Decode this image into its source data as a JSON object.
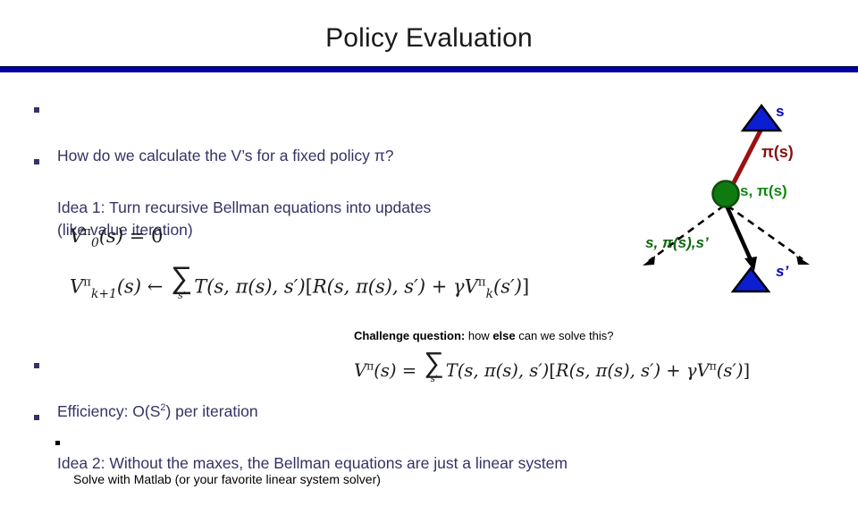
{
  "slide": {
    "title": "Policy Evaluation",
    "accent_bar_color": "#0000b4",
    "body_text_color": "#333366"
  },
  "bullets": [
    {
      "id": "how-do-we-calculate",
      "text": "How do we calculate the V’s for a fixed policy π?",
      "level": 1
    },
    {
      "id": "idea-1",
      "text": "Idea 1: Turn recursive Bellman equations into updates\n(like value iteration)",
      "level": 1
    },
    {
      "id": "efficiency",
      "text_before_sup": "Efficiency: O(S",
      "sup": "2",
      "text_after_sup": ") per iteration",
      "level": 1
    },
    {
      "id": "idea-2",
      "text": "Idea 2: Without the maxes, the Bellman equations are just a linear system",
      "level": 1
    },
    {
      "id": "solve-with-matlab",
      "text": "Solve with Matlab (or your favorite linear system solver)",
      "level": 2
    }
  ],
  "equations": {
    "eq_init": {
      "label": "V0^pi(s) = 0",
      "V": "V",
      "pi_sup": "π",
      "k_sub": "0",
      "arg": "(s)",
      "rel": "=",
      "rhs": "0"
    },
    "eq_update": {
      "label": "V_{k+1}^pi(s) <- sum_{s'} T(s,pi(s),s')[R(s,pi(s),s') + gamma V_k^pi(s')]",
      "V": "V",
      "pi_sup": "π",
      "k_sub": "k+1",
      "arg": "(s)",
      "rel": "←",
      "sum_glyph": "∑",
      "sum_sub": "s′",
      "T": "T(s, π(s), s′)",
      "bracket_open": "[",
      "R": "R(s, π(s), s′)",
      "plus": "+",
      "gamma": "γ",
      "V2": "V",
      "k2_sub": "k",
      "arg2": "(s′)",
      "bracket_close": "]"
    },
    "eq_linear": {
      "label": "V^pi(s) = sum_{s'} T(s,pi(s),s')[R(s,pi(s),s') + gamma V^pi(s')]",
      "V": "V",
      "pi_sup": "π",
      "arg": "(s)",
      "rel": "=",
      "sum_glyph": "∑",
      "sum_sub": "s′",
      "T": "T(s, π(s), s′)",
      "bracket_open": "[",
      "R": "R(s, π(s), s′)",
      "plus": "+",
      "gamma": "γ",
      "V2": "V",
      "pi_sup2": "π",
      "arg2": "(s′)",
      "bracket_close": "]"
    }
  },
  "challenge": {
    "bold_lead": "Challenge question:",
    "mid_regular": " how ",
    "bold_mid": "else",
    "tail_regular": " can we solve this?"
  },
  "diagram": {
    "name": "policy-evaluation-backup-diagram",
    "state_label_top": "s",
    "action_label": "π(s)",
    "qstate_label": "s, π(s)",
    "transition_label": "s, π(s),s’",
    "next_state_label": "s’",
    "colors": {
      "state_triangle": "#0b1fd0",
      "triangle_outline": "#000000",
      "qstate_circle": "#0f7a10",
      "qstate_outline": "#0a4f0a",
      "policy_arrow": "#9b1111",
      "sample_arrow": "#000000",
      "transition_dashes": "#000000",
      "state_label": "#0000c0",
      "action_label": "#8b0f10",
      "qstate_text": "#118811",
      "transition_text": "#116611"
    }
  }
}
